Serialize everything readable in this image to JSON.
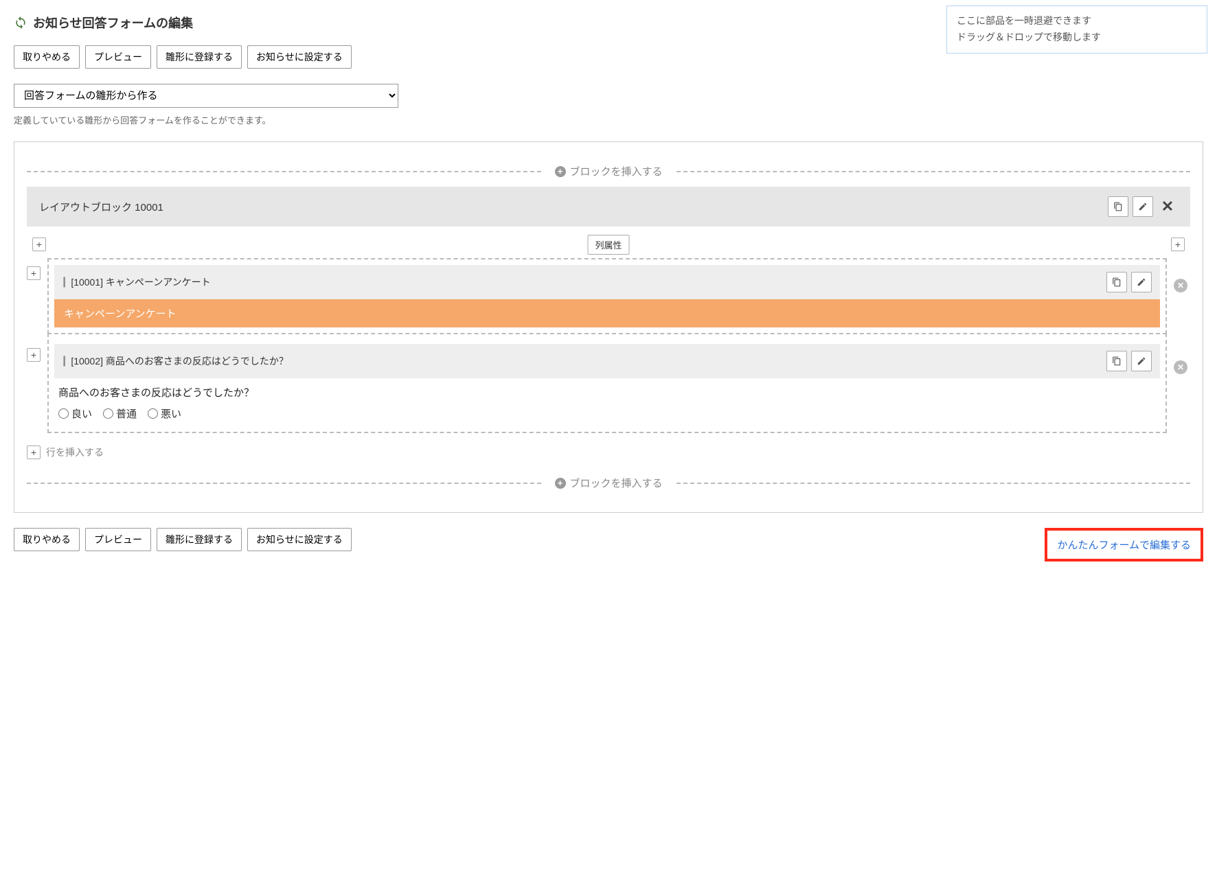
{
  "header": {
    "title": "お知らせ回答フォームの編集"
  },
  "tooltip": {
    "line1": "ここに部品を一時退避できます",
    "line2": "ドラッグ＆ドロップで移動します"
  },
  "buttons": {
    "cancel": "取りやめる",
    "preview": "プレビュー",
    "save_template": "雛形に登録する",
    "apply": "お知らせに設定する"
  },
  "template_select": {
    "placeholder": "回答フォームの雛形から作る",
    "help": "定義していている雛形から回答フォームを作ることができます。"
  },
  "insert_block": "ブロックを挿入する",
  "block": {
    "title": "レイアウトブロック 10001",
    "column_attr": "列属性"
  },
  "items": [
    {
      "id": "10001",
      "header": "[10001] キャンペーンアンケート",
      "banner": "キャンペーンアンケート"
    },
    {
      "id": "10002",
      "header": "[10002] 商品へのお客さまの反応はどうでしたか？",
      "prompt": "商品へのお客さまの反応はどうでしたか？",
      "options": [
        "良い",
        "普通",
        "悪い"
      ]
    }
  ],
  "insert_row": "行を挿入する",
  "easy_form_link": "かんたんフォームで編集する"
}
